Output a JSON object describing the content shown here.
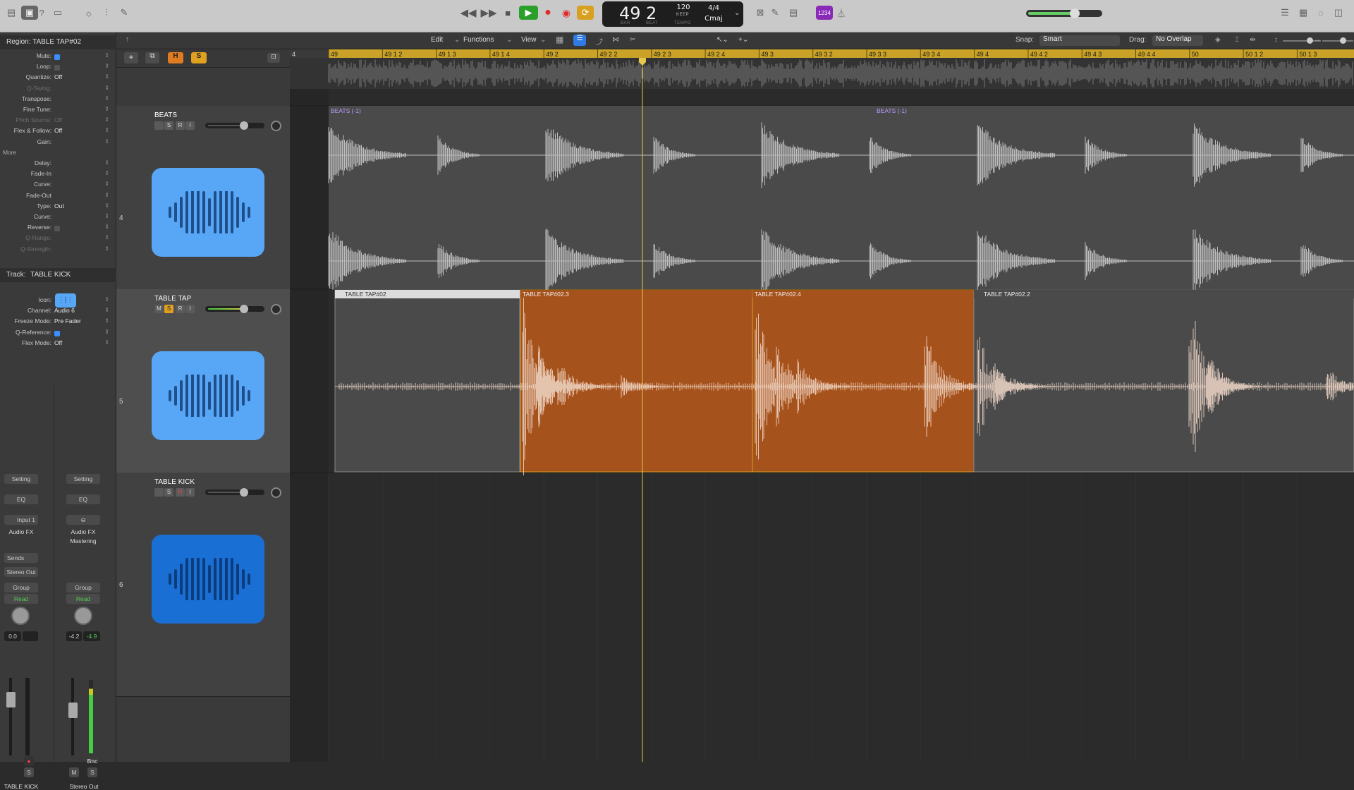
{
  "control_bar": {
    "lcd": {
      "bar": "49",
      "beat": "2",
      "bar_label": "BAR",
      "beat_label": "BEAT",
      "tempo": "120",
      "tempo_mode": "KEEP",
      "tempo_label": "TEMPO",
      "time_signature": "4/4",
      "key": "Cmaj"
    },
    "counter_badge": "1234",
    "master_volume_level": 0.6
  },
  "inspector": {
    "region_header": {
      "label": "Region:",
      "name": "TABLE TAP#02"
    },
    "region_rows": [
      {
        "label": "Mute:",
        "value": "",
        "check": true
      },
      {
        "label": "Loop:",
        "value": "",
        "check": false
      },
      {
        "label": "Quantize:",
        "value": "Off"
      },
      {
        "label": "Q-Swing:",
        "value": "",
        "dim": true
      },
      {
        "label": "Transpose:",
        "value": ""
      },
      {
        "label": "Fine Tune:",
        "value": ""
      },
      {
        "label": "Pitch Source:",
        "value": "Off",
        "dim": true
      },
      {
        "label": "Flex & Follow:",
        "value": "Off"
      },
      {
        "label": "Gain:",
        "value": ""
      }
    ],
    "more_label": "More",
    "more_rows": [
      {
        "label": "Delay:",
        "value": ""
      },
      {
        "label": "Fade-In",
        "value": ""
      },
      {
        "label": "Curve:",
        "value": ""
      },
      {
        "label": "Fade-Out",
        "value": ""
      },
      {
        "label": "Type:",
        "value": "Out"
      },
      {
        "label": "Curve:",
        "value": ""
      },
      {
        "label": "Reverse:",
        "value": "",
        "check": false
      },
      {
        "label": "Q-Range:",
        "value": "",
        "dim": true
      },
      {
        "label": "Q-Strength:",
        "value": "",
        "dim": true
      }
    ],
    "track_header": {
      "label": "Track:",
      "name": "TABLE KICK"
    },
    "track_rows": [
      {
        "label": "Icon:",
        "value": ""
      },
      {
        "label": "Channel:",
        "value": "Audio 6"
      },
      {
        "label": "Freeze Mode:",
        "value": "Pre Fader"
      },
      {
        "label": "Q-Reference:",
        "value": "",
        "check": true
      },
      {
        "label": "Flex Mode:",
        "value": "Off"
      }
    ],
    "strips": [
      {
        "setting": "Setting",
        "eq": "EQ",
        "input": "Input 1",
        "fx": "Audio FX",
        "fx2": "",
        "sends": "Sends",
        "output": "Stereo Out",
        "group": "Group",
        "read": "Read",
        "vol": "0.0",
        "peak": "",
        "bottom_btns": [
          "S"
        ],
        "name": "TABLE KICK"
      },
      {
        "setting": "Setting",
        "eq": "EQ",
        "input": "",
        "fx": "Audio FX",
        "fx2": "Mastering",
        "sends": "",
        "output": "",
        "group": "Group",
        "read": "Read",
        "vol": "-4.2",
        "peak": "-4.9",
        "bnc": "Bnc",
        "bottom_btns": [
          "M",
          "S"
        ],
        "name": "Stereo Out"
      }
    ]
  },
  "arrange_toolbar": {
    "edit": "Edit",
    "functions": "Functions",
    "view": "View",
    "snap_label": "Snap:",
    "snap_value": "Smart",
    "drag_label": "Drag:",
    "drag_value": "No Overlap"
  },
  "ruler": {
    "start_label": "4",
    "marks": [
      "49",
      "49 1 2",
      "49 1 3",
      "49 1 4",
      "49 2",
      "49 2 2",
      "49 2 3",
      "49 2 4",
      "49 3",
      "49 3 2",
      "49 3 3",
      "49 3 4",
      "49 4",
      "49 4 2",
      "49 4 3",
      "49 4 4",
      "50",
      "50 1 2",
      "50 1 3"
    ]
  },
  "tracks": [
    {
      "number": "4",
      "name": "BEATS",
      "buttons": [
        "",
        "S",
        "R",
        "I"
      ],
      "volume": 0.58,
      "icon": "waveform-icon",
      "color": "#58a7f7"
    },
    {
      "number": "5",
      "name": "TABLE TAP",
      "buttons": [
        "M",
        "S",
        "R",
        "I"
      ],
      "volume": 0.58,
      "icon": "waveform-icon",
      "color": "#58a7f7"
    },
    {
      "number": "6",
      "name": "TABLE KICK",
      "buttons": [
        "",
        "S",
        "R",
        "I"
      ],
      "volume": 0.58,
      "icon": "waveform-icon",
      "color": "#1a6fd4"
    }
  ],
  "regions": {
    "beats": [
      {
        "name": "BEATS (-1)"
      },
      {
        "name": "BEATS (-1)"
      }
    ],
    "table_tap": [
      {
        "name": "TABLE TAP#02",
        "selected": false
      },
      {
        "name": "TABLE TAP#02.3",
        "selected": true
      },
      {
        "name": "TABLE TAP#02.4",
        "selected": true
      },
      {
        "name": "TABLE TAP#02.2",
        "selected": false
      }
    ]
  },
  "colors": {
    "accent_blue": "#3a8fff",
    "region_orange": "#a6521c",
    "ruler_yellow": "#c9a227",
    "play_green": "#2aa02a",
    "record_red": "#e02a2a",
    "cycle_gold": "#d8a020"
  }
}
